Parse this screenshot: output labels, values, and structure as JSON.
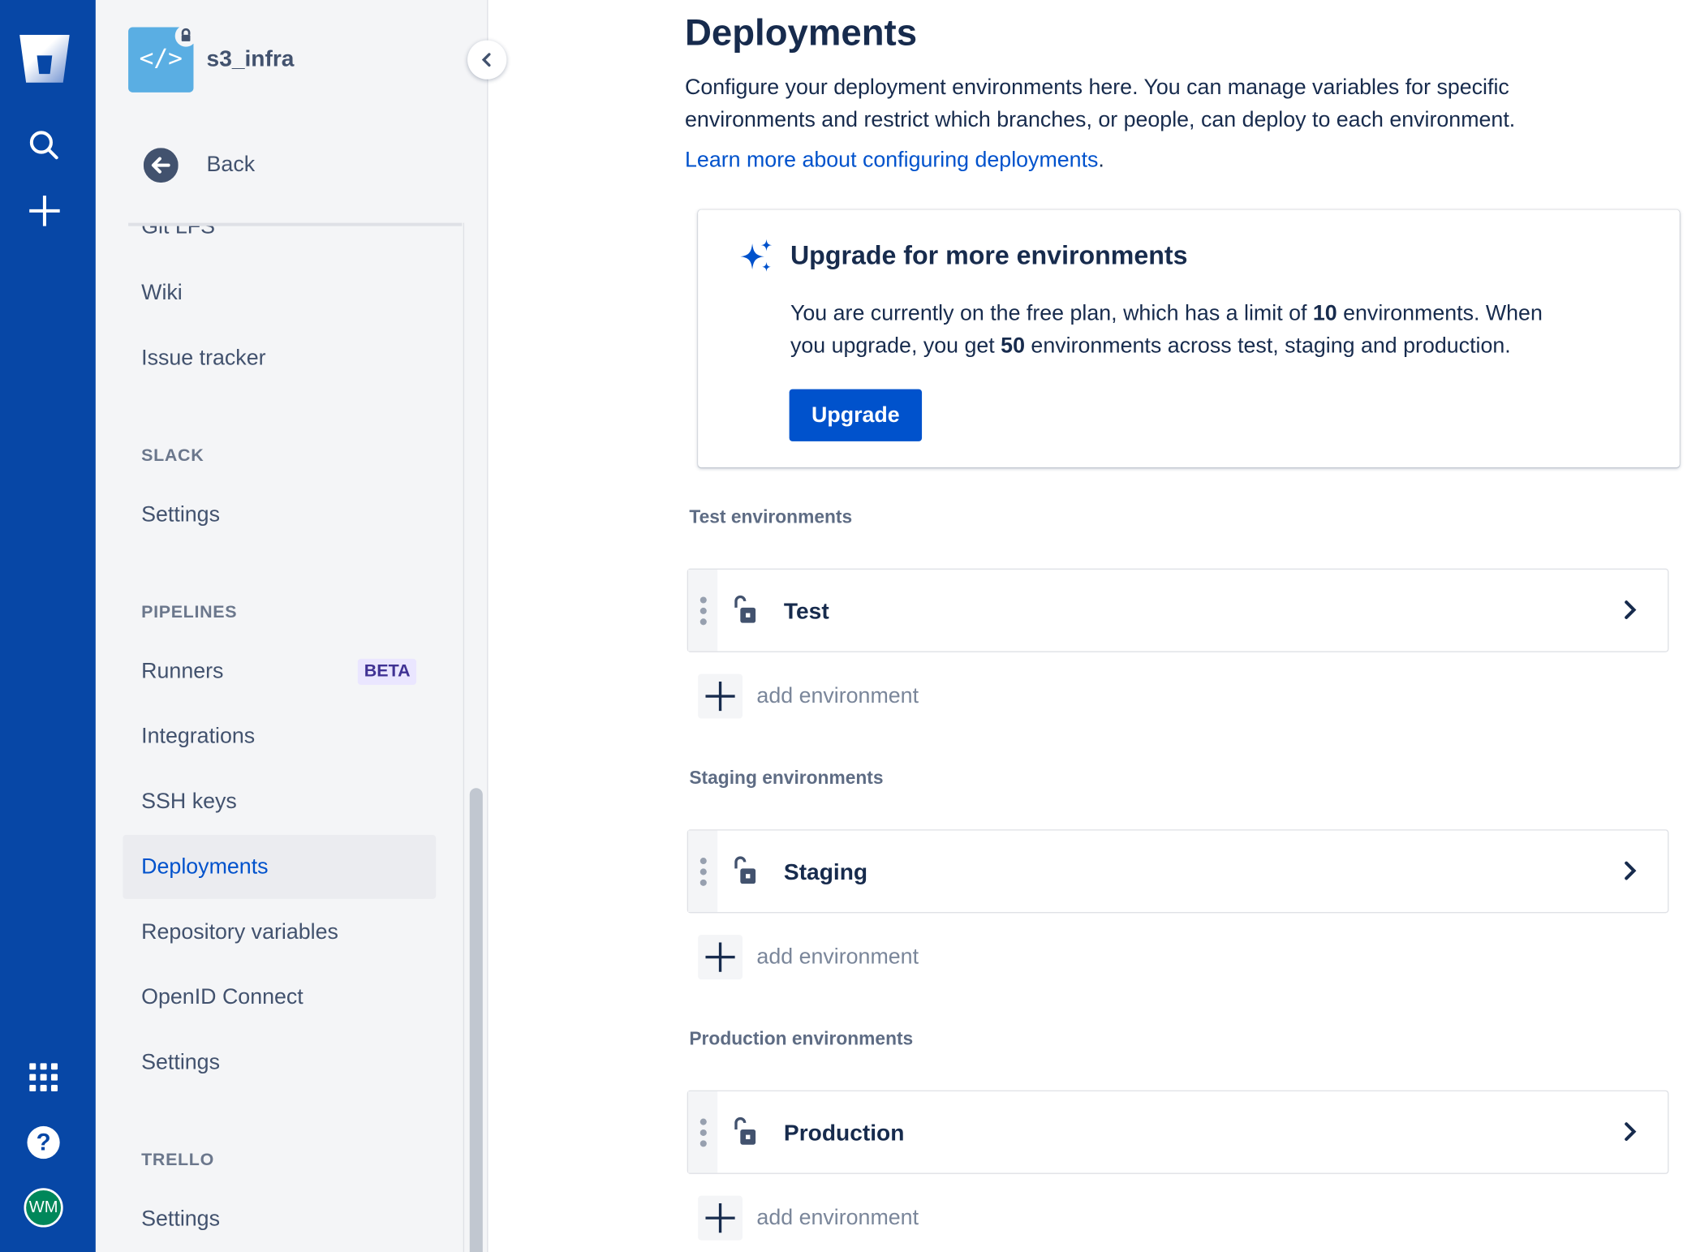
{
  "global_nav": {
    "icons": [
      "bitbucket-logo",
      "search-icon",
      "plus-icon",
      "apps-grid-icon",
      "help-icon"
    ],
    "avatar_initials": "WM",
    "color": "#0747A6"
  },
  "sidebar": {
    "repo_name": "s3_infra",
    "back_label": "Back",
    "items_top": [
      "Git LFS",
      "Wiki",
      "Issue tracker"
    ],
    "slack": {
      "header": "SLACK",
      "items": [
        "Settings"
      ]
    },
    "pipelines": {
      "header": "PIPELINES",
      "items": [
        "Runners",
        "Integrations",
        "SSH keys",
        "Deployments",
        "Repository variables",
        "OpenID Connect",
        "Settings"
      ],
      "runners_badge": "BETA",
      "selected": "Deployments"
    },
    "trello": {
      "header": "TRELLO",
      "items": [
        "Settings"
      ]
    }
  },
  "main": {
    "title": "Deployments",
    "description_1": "Configure your deployment environments here. You can manage variables for specific",
    "description_2": "environments and restrict which branches, or people, can deploy to each environment.",
    "learn_more": "Learn more about configuring deployments",
    "learn_more_suffix": ".",
    "upgrade_card": {
      "heading": "Upgrade for more environments",
      "line1_a": "You are currently on the free plan, which has a limit of ",
      "line1_b": "10",
      "line1_c": " environments. When",
      "line2_a": "you upgrade, you get ",
      "line2_b": "50",
      "line2_c": " environments across test, staging and production.",
      "button": "Upgrade"
    },
    "sections": [
      {
        "label": "Test environments",
        "env": "Test",
        "add": "add environment"
      },
      {
        "label": "Staging environments",
        "env": "Staging",
        "add": "add environment"
      },
      {
        "label": "Production environments",
        "env": "Production",
        "add": "add environment"
      }
    ]
  }
}
